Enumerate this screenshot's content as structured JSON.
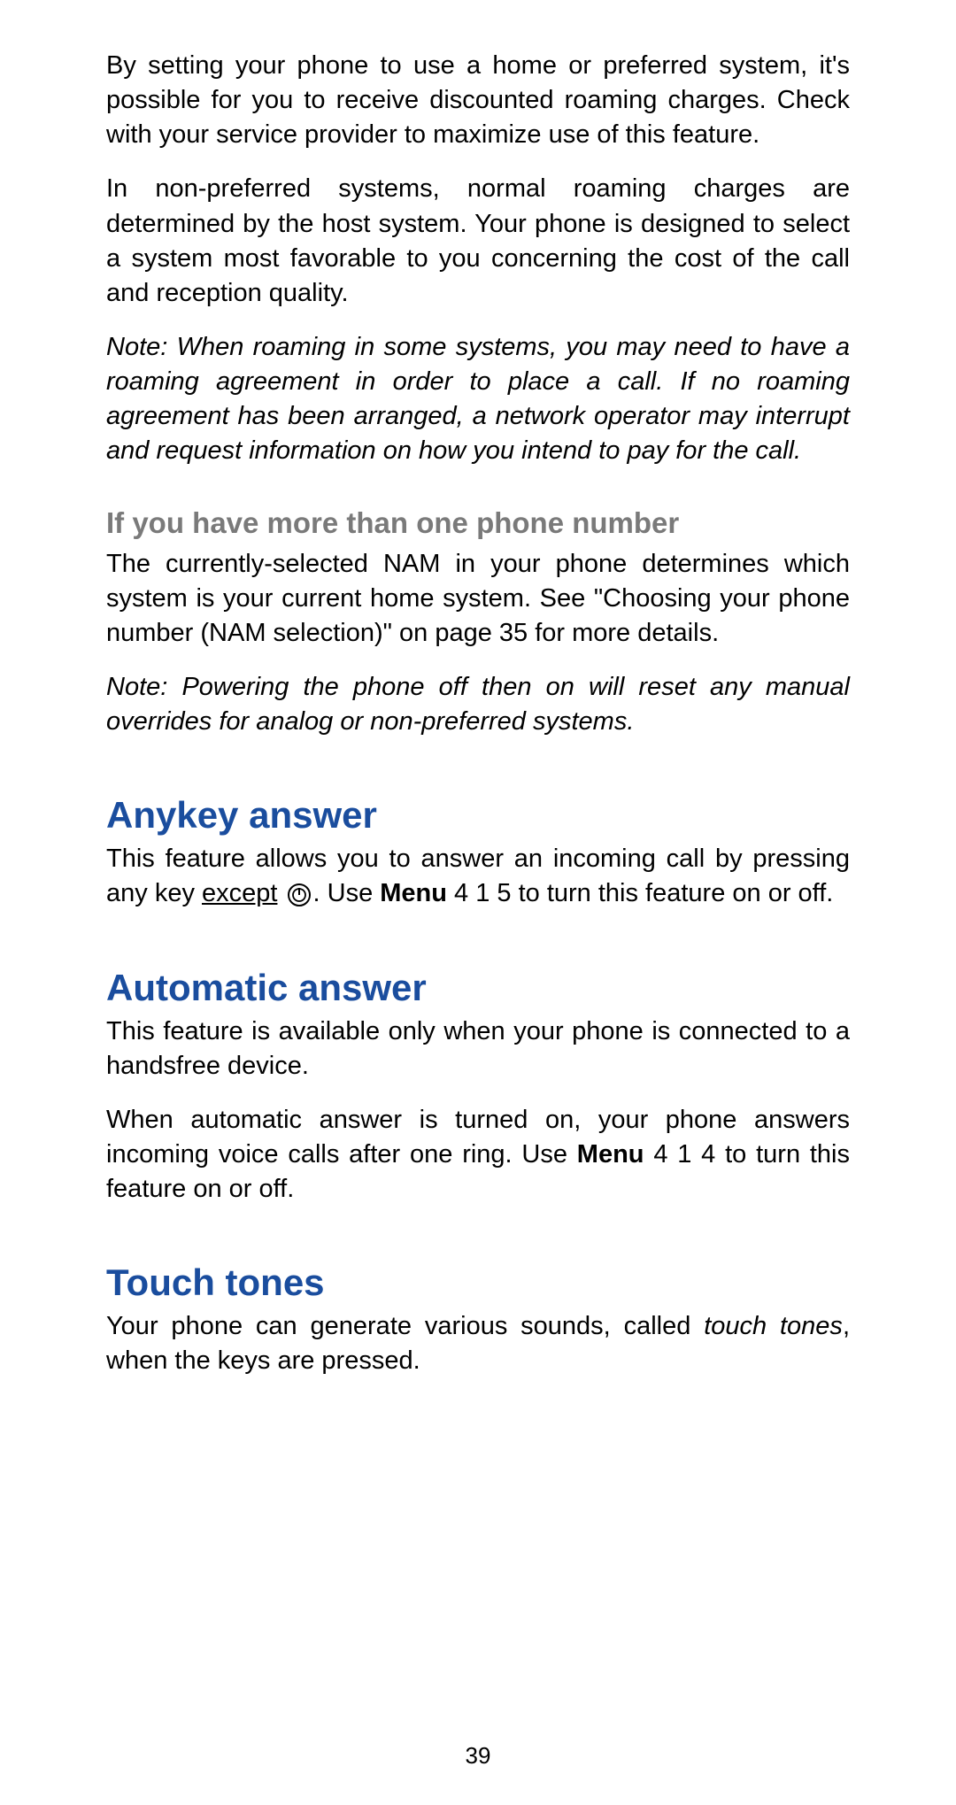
{
  "paragraphs": {
    "p1": "By setting your phone to use a home or preferred system, it's possible for you to receive discounted roaming charges. Check with your service provider to maximize use of this feature.",
    "p2": "In non-preferred systems, normal roaming charges are determined by the host system. Your phone is designed to select a system most favorable to you concerning the cost of the call and reception quality.",
    "note1": "Note: When roaming in some systems, you may need to have a roaming agreement in order to place a call. If no roaming agreement has been arranged, a network operator may interrupt and request information on how you intend to pay for the call.",
    "sub1_heading": "If you have more than one phone number",
    "p3": "The currently-selected NAM in your phone determines which system is your current home system. See \"Choosing your phone number (NAM selection)\" on page 35 for more details.",
    "note2": "Note: Powering the phone off then on will reset any manual overrides for analog or non-preferred systems.",
    "anykey_heading": "Anykey answer",
    "anykey_p1_part1": "This feature allows you to answer an incoming call by pressing any key ",
    "anykey_p1_except": "except",
    "anykey_p1_part2": ". Use ",
    "anykey_p1_menu": "Menu",
    "anykey_p1_part3": " 4 1 5 to turn this feature on or off.",
    "auto_heading": "Automatic answer",
    "auto_p1": "This feature is available only when your phone is connected to a handsfree device.",
    "auto_p2_part1": "When automatic answer is turned on, your phone answers incoming voice calls after one ring. Use ",
    "auto_p2_menu": "Menu",
    "auto_p2_part2": " 4 1 4 to turn this feature on or off.",
    "touch_heading": "Touch tones",
    "touch_p1_part1": "Your phone can generate various sounds, called ",
    "touch_p1_italic": "touch tones",
    "touch_p1_part2": ", when the keys are pressed."
  },
  "page_number": "39"
}
